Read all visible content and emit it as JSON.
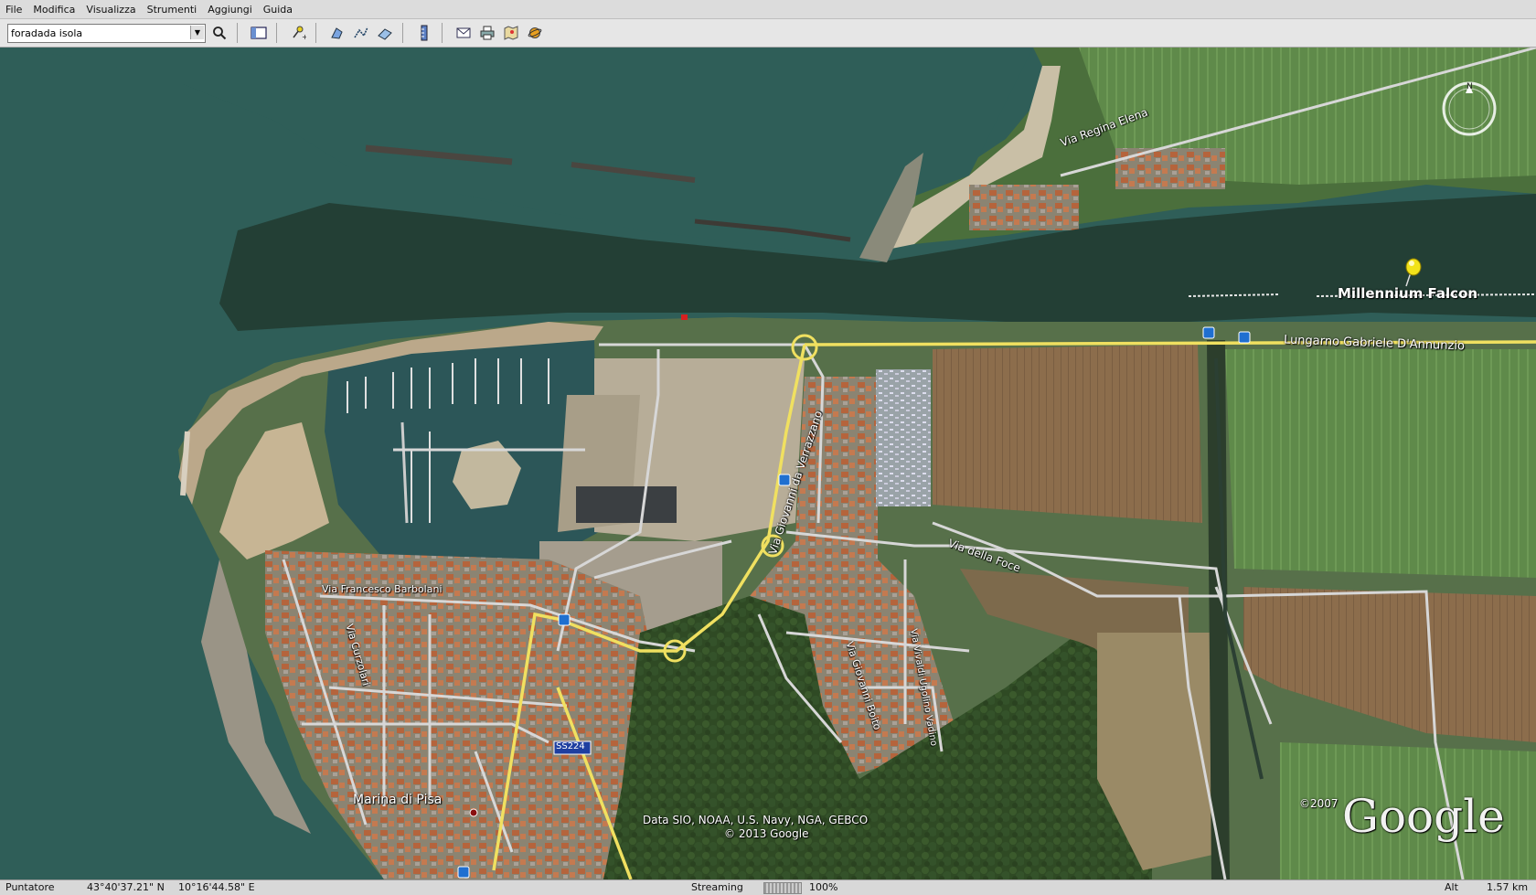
{
  "menu": [
    "File",
    "Modifica",
    "Visualizza",
    "Strumenti",
    "Aggiungi",
    "Guida"
  ],
  "search": {
    "value": "foradada isola"
  },
  "labels": {
    "via_regina_elena": "Via Regina Elena",
    "millennium_falcon": "Millennium Falcon",
    "lungarno": "Lungarno Gabriele D'Annunzio",
    "via_verrazzano": "Via Giovanni da Verrazzano",
    "via_della_foce": "Via della Foce",
    "via_barbolani": "Via Francesco Barbolani",
    "via_curzolari": "Via Curzolari",
    "via_giovanni_boito": "Via Giovanni Boito",
    "via_vivaldi": "Via Vivaldi Ugolino Vadino",
    "marina_di_pisa": "Marina di Pisa",
    "ss224": "SS224",
    "attribution_line1": "Data SIO, NOAA, U.S. Navy, NGA, GEBCO",
    "attribution_line2": "© 2013 Google",
    "copyright": "©2007",
    "google": "Google",
    "compass_n": "N"
  },
  "status": {
    "pointer_label": "Puntatore",
    "lat": "43°40'37.21\" N",
    "lon": "10°16'44.58\" E",
    "streaming_label": "Streaming",
    "streaming_pct": "100%",
    "alt_label": "Alt",
    "alt_value": "1.57 km"
  },
  "colors": {
    "sea": "#2f5e58",
    "river": "#233f35",
    "road_yellow": "#f0e060",
    "pin": "#f2e21a"
  }
}
